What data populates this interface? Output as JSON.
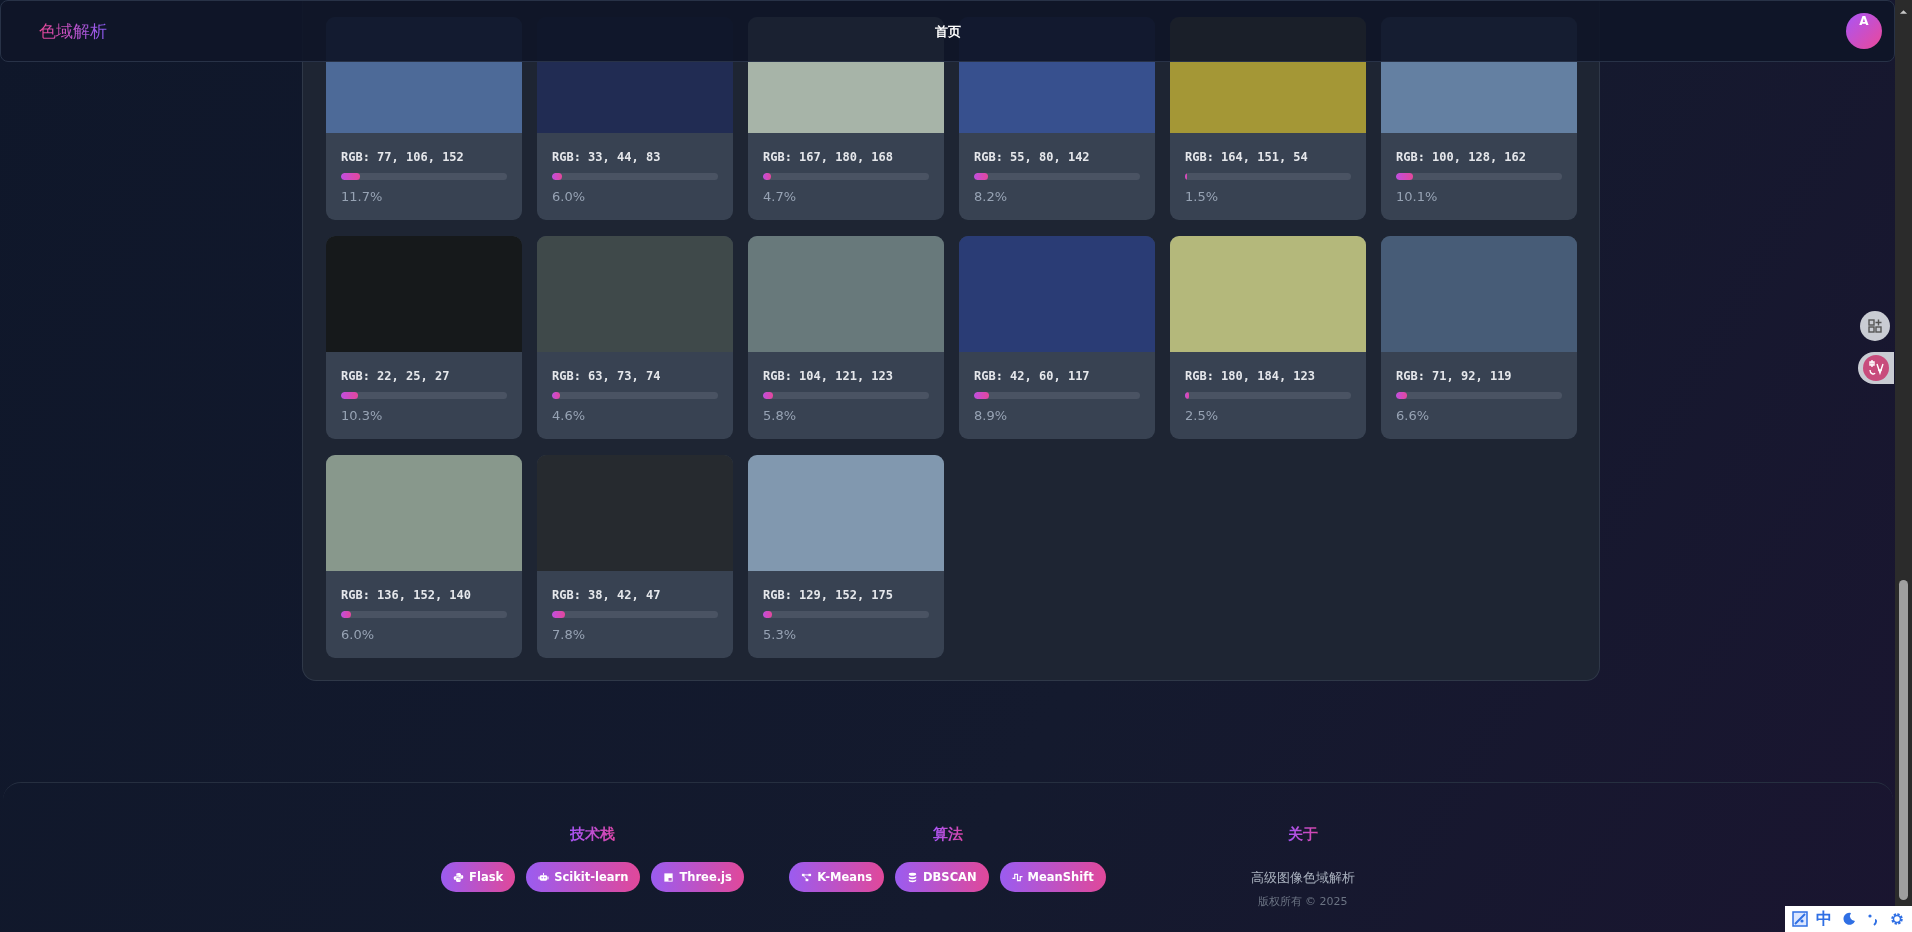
{
  "header": {
    "logo": "色域解析",
    "nav": [
      "首页"
    ],
    "avatar": "A"
  },
  "colors": [
    {
      "rgb": "RGB: 77, 106, 152",
      "color": "#4d6a98",
      "level": 0.117,
      "percent": "11.7%"
    },
    {
      "rgb": "RGB: 33, 44, 83",
      "color": "#212c53",
      "level": 0.06,
      "percent": "6.0%"
    },
    {
      "rgb": "RGB: 167, 180, 168",
      "color": "#a7b4a8",
      "level": 0.047,
      "percent": "4.7%"
    },
    {
      "rgb": "RGB: 55, 80, 142",
      "color": "#37508e",
      "level": 0.082,
      "percent": "8.2%"
    },
    {
      "rgb": "RGB: 164, 151, 54",
      "color": "#a49736",
      "level": 0.015,
      "percent": "1.5%"
    },
    {
      "rgb": "RGB: 100, 128, 162",
      "color": "#6480a2",
      "level": 0.101,
      "percent": "10.1%"
    },
    {
      "rgb": "RGB: 22, 25, 27",
      "color": "#16191b",
      "level": 0.103,
      "percent": "10.3%"
    },
    {
      "rgb": "RGB: 63, 73, 74",
      "color": "#3f494a",
      "level": 0.046,
      "percent": "4.6%"
    },
    {
      "rgb": "RGB: 104, 121, 123",
      "color": "#68797b",
      "level": 0.058,
      "percent": "5.8%"
    },
    {
      "rgb": "RGB: 42, 60, 117",
      "color": "#2a3c75",
      "level": 0.089,
      "percent": "8.9%"
    },
    {
      "rgb": "RGB: 180, 184, 123",
      "color": "#b4b87b",
      "level": 0.025,
      "percent": "2.5%"
    },
    {
      "rgb": "RGB: 71, 92, 119",
      "color": "#475c77",
      "level": 0.066,
      "percent": "6.6%"
    },
    {
      "rgb": "RGB: 136, 152, 140",
      "color": "#88988c",
      "level": 0.06,
      "percent": "6.0%"
    },
    {
      "rgb": "RGB: 38, 42, 47",
      "color": "#262a2f",
      "level": 0.078,
      "percent": "7.8%"
    },
    {
      "rgb": "RGB: 129, 152, 175",
      "color": "#8198af",
      "level": 0.053,
      "percent": "5.3%"
    }
  ],
  "footer": {
    "sections": [
      {
        "title": "技术栈",
        "chips": [
          "Flask",
          "Scikit-learn",
          "Three.js"
        ]
      },
      {
        "title": "算法",
        "chips": [
          "K-Means",
          "DBSCAN",
          "MeanShift"
        ]
      },
      {
        "title": "关于",
        "lines": [
          "高级图像色域解析",
          "版权所有 © 2025"
        ]
      }
    ]
  },
  "tray": {
    "label": "中"
  }
}
